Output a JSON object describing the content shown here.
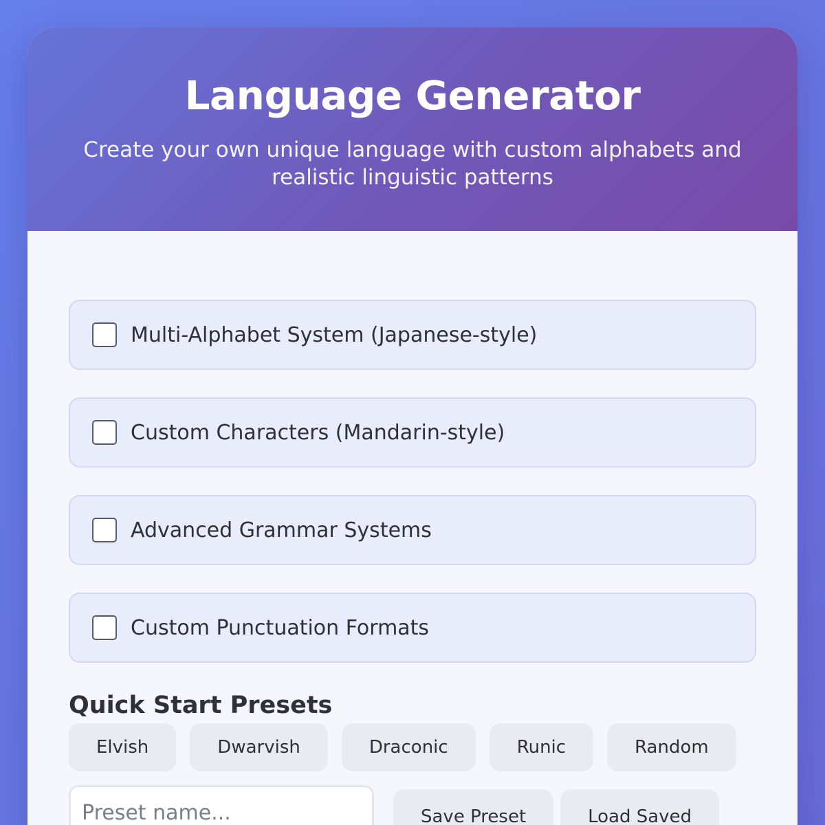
{
  "header": {
    "title": "Language Generator",
    "subtitle": "Create your own unique language with custom alphabets and realistic linguistic patterns"
  },
  "options": [
    {
      "label": "Multi-Alphabet System (Japanese-style)",
      "checked": false
    },
    {
      "label": "Custom Characters (Mandarin-style)",
      "checked": false
    },
    {
      "label": "Advanced Grammar Systems",
      "checked": false
    },
    {
      "label": "Custom Punctuation Formats",
      "checked": false
    }
  ],
  "presets": {
    "title": "Quick Start Presets",
    "buttons": [
      "Elvish",
      "Dwarvish",
      "Draconic",
      "Runic",
      "Random"
    ]
  },
  "save": {
    "input_value": "",
    "input_placeholder": "Preset name...",
    "save_label": "Save Preset",
    "load_label": "Load Saved"
  },
  "colors": {
    "background": "#667eea",
    "header_start": "#6674d8",
    "header_end": "#784aa8",
    "option_bg": "#e8ecfb",
    "button_bg": "#e9ebf0"
  }
}
